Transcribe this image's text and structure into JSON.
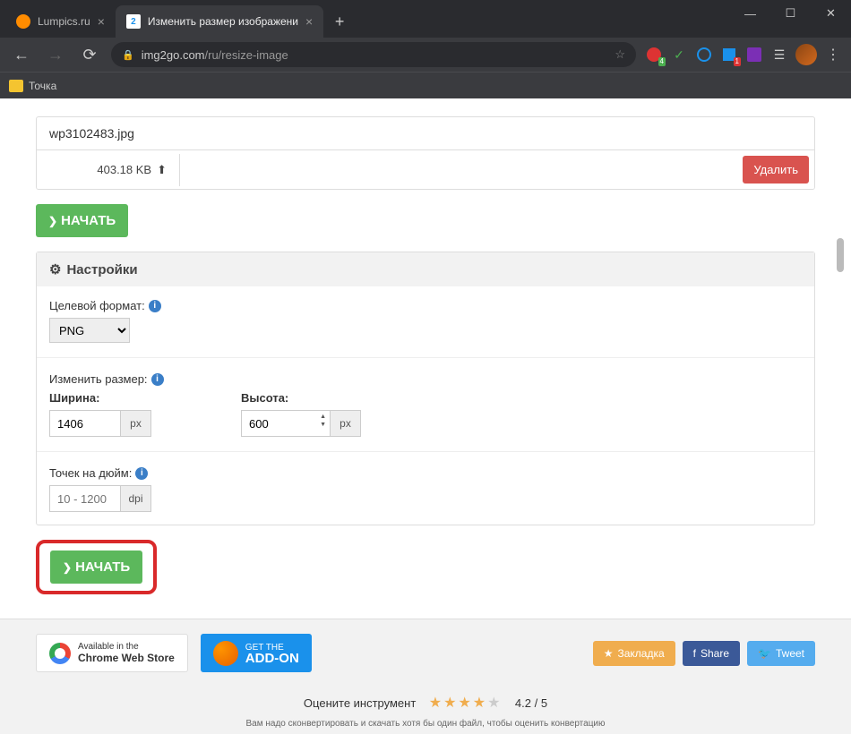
{
  "browser": {
    "tabs": [
      {
        "title": "Lumpics.ru"
      },
      {
        "title": "Изменить размер изображени"
      }
    ],
    "url_host": "img2go.com",
    "url_path": "/ru/resize-image",
    "bookmark_item": "Точка",
    "ext_badge_1": "4",
    "ext_badge_2": "1"
  },
  "file": {
    "name": "wp3102483.jpg",
    "size": "403.18 KB",
    "delete_label": "Удалить"
  },
  "buttons": {
    "start": "НАЧАТЬ"
  },
  "settings": {
    "heading": "Настройки",
    "target_format_label": "Целевой формат:",
    "target_format_value": "PNG",
    "resize_label": "Изменить размер:",
    "width_label": "Ширина:",
    "width_value": "1406",
    "height_label": "Высота:",
    "height_value": "600",
    "unit_px": "px",
    "dpi_label": "Точек на дюйм:",
    "dpi_placeholder": "10 - 1200",
    "unit_dpi": "dpi"
  },
  "promo": {
    "chrome_line1": "Available in the",
    "chrome_line2": "Chrome Web Store",
    "addon_line1": "GET THE",
    "addon_line2": "ADD-ON",
    "bookmark": "Закладка",
    "share": "Share",
    "tweet": "Tweet"
  },
  "rating": {
    "label": "Оцените инструмент",
    "value": "4.2 / 5",
    "note": "Вам надо сконвертировать и скачать хотя бы один файл, чтобы оценить конвертацию"
  }
}
